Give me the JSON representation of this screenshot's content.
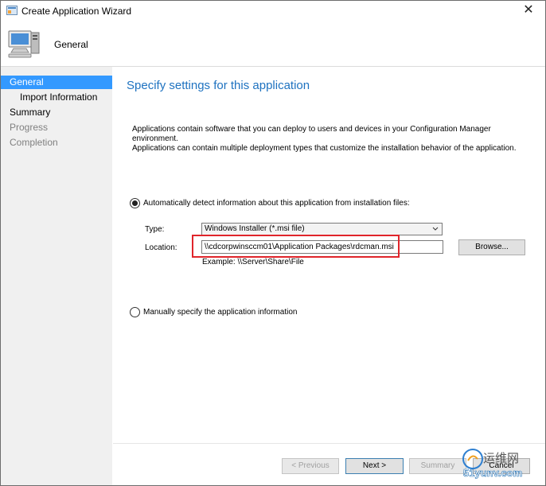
{
  "window": {
    "title": "Create Application Wizard",
    "close_glyph": "✕"
  },
  "header": {
    "title": "General",
    "icon": "computer-icon"
  },
  "sidebar": {
    "items": [
      {
        "label": "General",
        "active": true
      },
      {
        "label": "Import Information",
        "active": false
      },
      {
        "label": "Summary",
        "active": false
      },
      {
        "label": "Progress",
        "active": false
      },
      {
        "label": "Completion",
        "active": false
      }
    ]
  },
  "content": {
    "heading": "Specify settings for this application",
    "description_line1": "Applications contain software that you can deploy to users and devices in your Configuration Manager environment.",
    "description_line2": "Applications can contain multiple deployment types that customize the installation behavior of the application.",
    "auto_detect_label": "Automatically detect information about this application from installation files:",
    "type_label": "Type:",
    "type_value": "Windows Installer (*.msi file)",
    "location_label": "Location:",
    "location_value": "\\\\cdcorpwinsccm01\\Application Packages\\rdcman.msi",
    "example_text": "Example: \\\\Server\\Share\\File",
    "browse_label": "Browse...",
    "manual_label": "Manually specify the application information"
  },
  "footer": {
    "previous_label": "< Previous",
    "next_label": "Next >",
    "summary_label": "Summary",
    "cancel_label": "Cancel"
  },
  "watermark": {
    "line1": "运维网",
    "line2": "51yunv.com"
  },
  "colors": {
    "accent": "#3399ff",
    "heading": "#1e72c0",
    "highlight": "#e0252b"
  }
}
